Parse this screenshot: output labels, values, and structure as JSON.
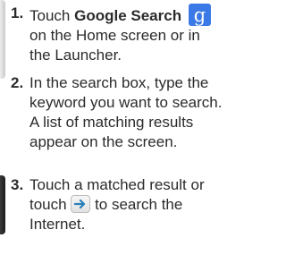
{
  "steps": [
    {
      "number": "1.",
      "prefix": "Touch ",
      "app_name": "Google Search",
      "suffix": "on the Home screen or in the Launcher.",
      "icon": "google-search-icon",
      "icon_color": "#3b79e6"
    },
    {
      "number": "2.",
      "text": "In the search box, type the keyword you want to search.",
      "note": "A list of matching results appear on the screen."
    },
    {
      "number": "3.",
      "prefix": "Touch a matched result or touch",
      "suffix": "to search the Internet.",
      "icon": "arrow-right-icon",
      "icon_color": "#2a7fb8"
    }
  ]
}
